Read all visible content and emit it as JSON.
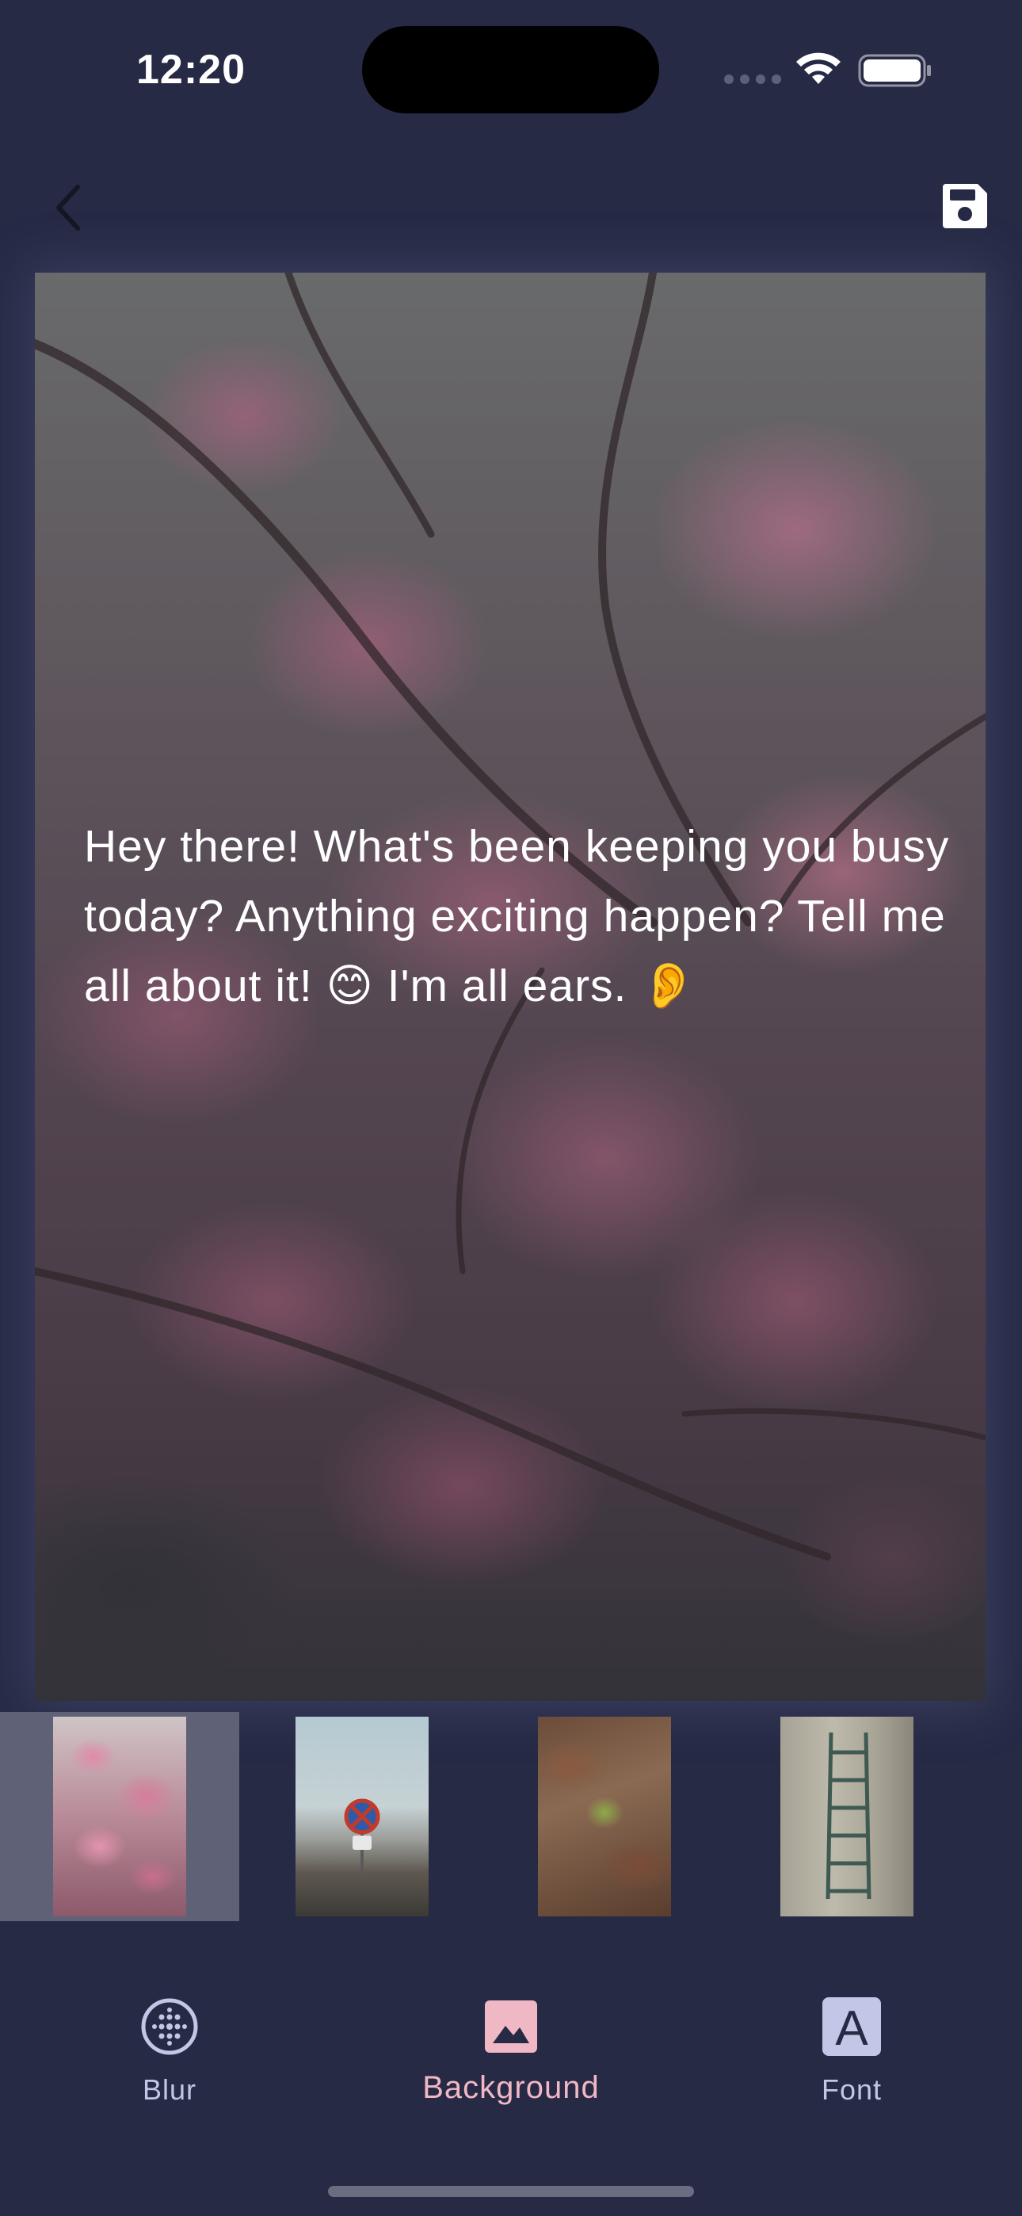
{
  "status_bar": {
    "time": "12:20",
    "icons": [
      "signal-icon",
      "wifi-icon",
      "battery-icon"
    ]
  },
  "nav": {
    "back_icon": "chevron-left-icon",
    "save_icon": "floppy-disk-icon"
  },
  "preview": {
    "message": "Hey there! What's been keeping you busy today? Anything exciting happen? Tell me all about it! 😊  I'm all ears. 👂",
    "background": "cherry-blossom-photo"
  },
  "thumbnails": [
    {
      "name": "cherry-blossom",
      "selected": true
    },
    {
      "name": "road-sign",
      "selected": false
    },
    {
      "name": "leaves",
      "selected": false
    },
    {
      "name": "ladder",
      "selected": false
    }
  ],
  "tabs": [
    {
      "label": "Blur",
      "icon": "blur-icon",
      "active": false
    },
    {
      "label": "Background",
      "icon": "image-icon",
      "active": true
    },
    {
      "label": "Font",
      "icon": "font-icon",
      "active": false
    }
  ],
  "colors": {
    "background": "#262a45",
    "tab_active": "#f0b7c5",
    "tab_inactive": "#c3c6e6",
    "selected_thumb": "#5f6276"
  }
}
